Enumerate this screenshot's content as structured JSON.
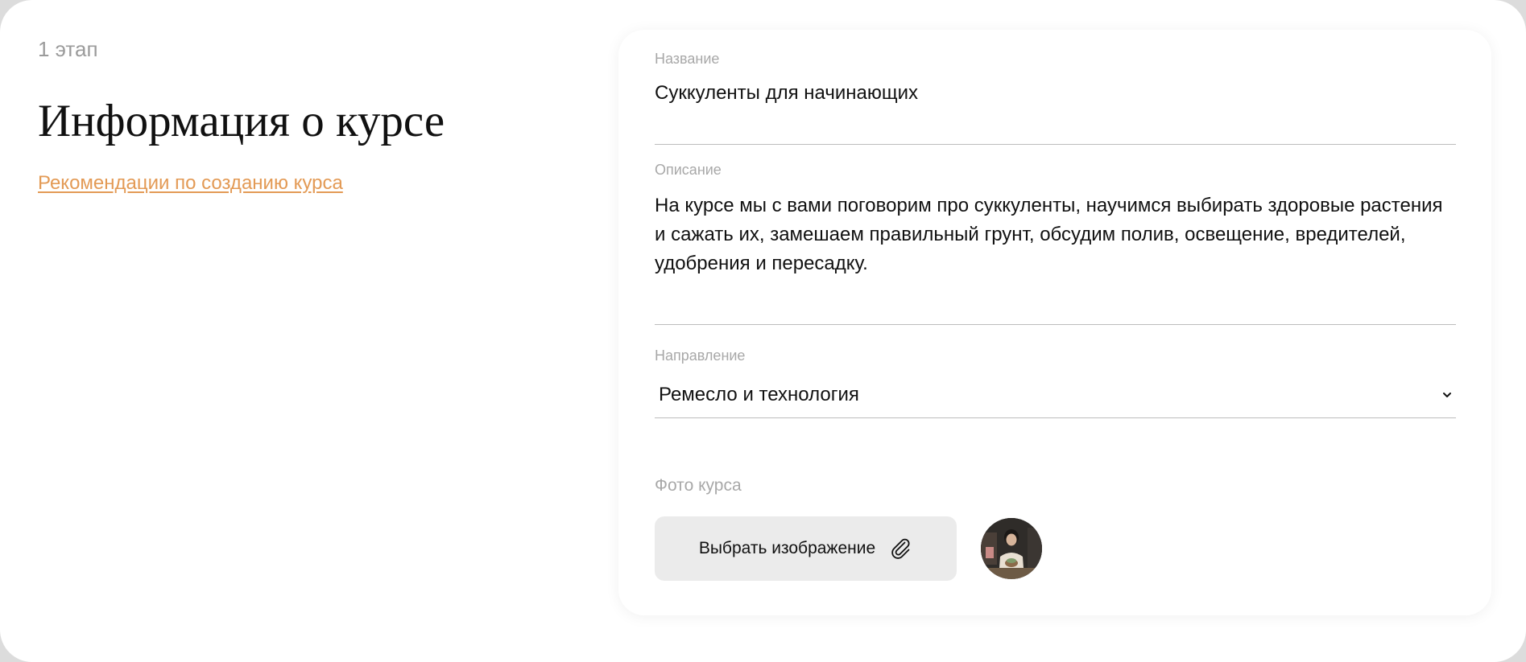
{
  "left": {
    "stage": "1 этап",
    "title": "Информация о курсе",
    "recommendations_link": "Рекомендации по созданию курса"
  },
  "form": {
    "name_label": "Название",
    "name_value": "Суккуленты для начинающих",
    "description_label": "Описание",
    "description_value": "На курсе мы с вами поговорим про суккуленты, научимся выбирать здоровые растения и сажать их, замешаем правильный грунт, обсудим полив, освещение, вредителей, удобрения и пересадку.",
    "direction_label": "Направление",
    "direction_value": "Ремесло и технология",
    "photo_label": "Фото курса",
    "pick_image_label": "Выбрать изображение"
  },
  "icons": {
    "chevron": "chevron-down-icon",
    "attach": "paperclip-icon"
  },
  "colors": {
    "link": "#e39a55",
    "muted_label": "#a8a8a8",
    "button_bg": "#ebebeb"
  }
}
